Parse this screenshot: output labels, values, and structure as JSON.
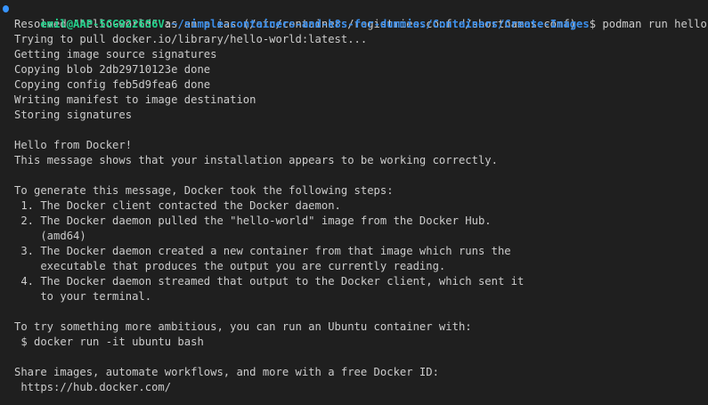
{
  "prompt": {
    "user_host": "emil@AAP-5CG9226S6V",
    "separator": ":",
    "path": "~/simple-containers-and-k8s-for-dummies/Containers/Create-Images",
    "symbol": "$",
    "command": " podman run hello-world"
  },
  "output": [
    "Resolved \"hello-world\" as an alias (/etc/containers/registries.conf.d/shortnames.conf)",
    "Trying to pull docker.io/library/hello-world:latest...",
    "Getting image source signatures",
    "Copying blob 2db29710123e done",
    "Copying config feb5d9fea6 done",
    "Writing manifest to image destination",
    "Storing signatures",
    "",
    "Hello from Docker!",
    "This message shows that your installation appears to be working correctly.",
    "",
    "To generate this message, Docker took the following steps:",
    " 1. The Docker client contacted the Docker daemon.",
    " 2. The Docker daemon pulled the \"hello-world\" image from the Docker Hub.",
    "    (amd64)",
    " 3. The Docker daemon created a new container from that image which runs the",
    "    executable that produces the output you are currently reading.",
    " 4. The Docker daemon streamed that output to the Docker client, which sent it",
    "    to your terminal.",
    "",
    "To try something more ambitious, you can run an Ubuntu container with:",
    " $ docker run -it ubuntu bash",
    "",
    "Share images, automate workflows, and more with a free Docker ID:",
    " https://hub.docker.com/"
  ]
}
